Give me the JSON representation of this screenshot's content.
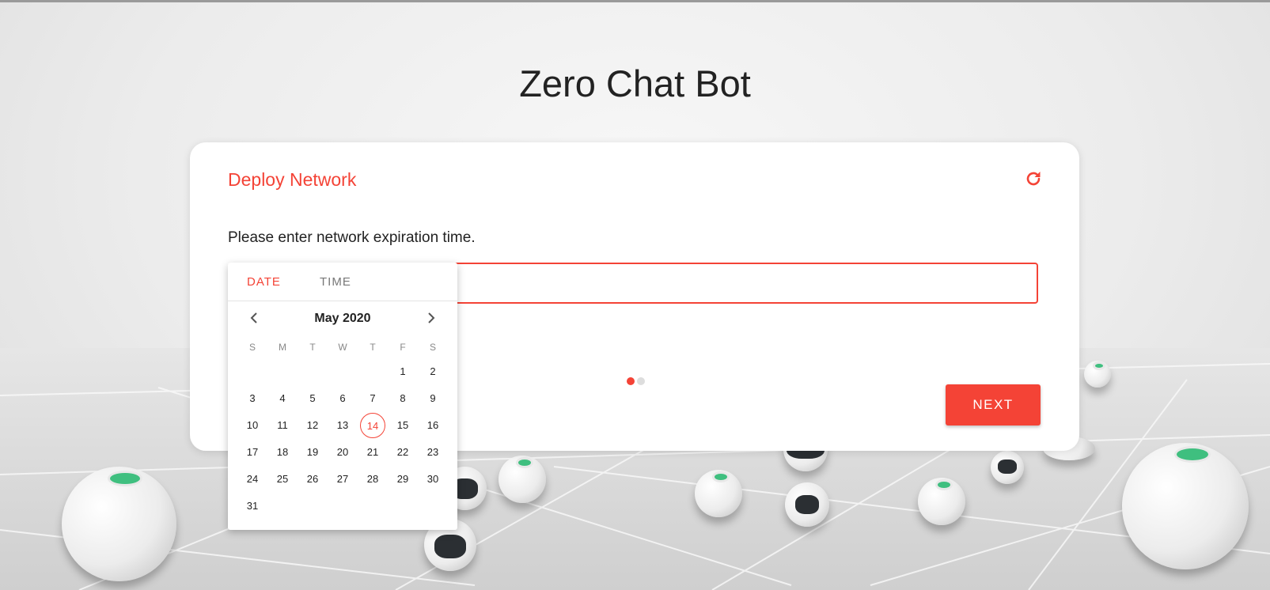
{
  "app": {
    "title": "Zero Chat Bot"
  },
  "card": {
    "title": "Deploy Network",
    "prompt": "Please enter network expiration time.",
    "input_value": "",
    "next_label": "NEXT",
    "step_current": 1,
    "step_total": 2
  },
  "picker": {
    "tabs": [
      "DATE",
      "TIME"
    ],
    "active_tab": "DATE",
    "month_label": "May 2020",
    "weekdays": [
      "S",
      "M",
      "T",
      "W",
      "T",
      "F",
      "S"
    ],
    "first_weekday_index": 5,
    "days_in_month": 31,
    "selected_day": 14
  },
  "colors": {
    "accent": "#f44336"
  },
  "icons": {
    "refresh": "refresh-icon",
    "prev": "chevron-left-icon",
    "next": "chevron-right-icon"
  }
}
